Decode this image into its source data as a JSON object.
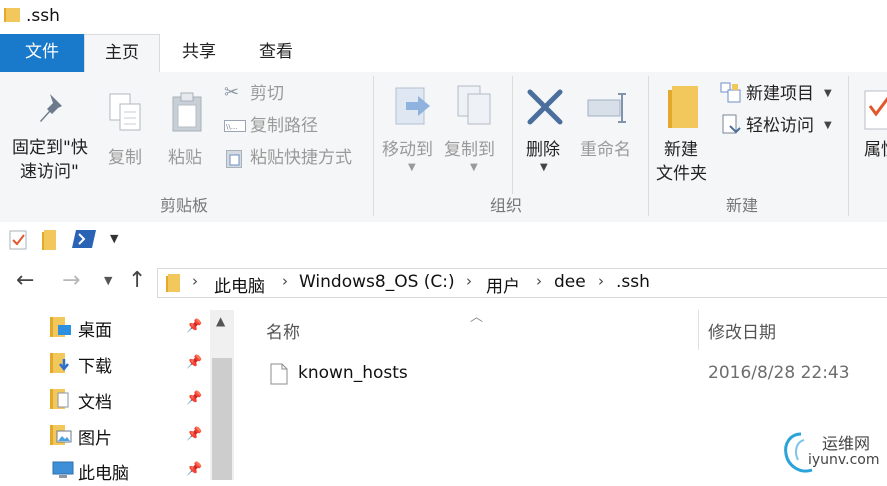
{
  "window": {
    "title": ".ssh"
  },
  "tabs": [
    {
      "label": "文件"
    },
    {
      "label": "主页"
    },
    {
      "label": "共享"
    },
    {
      "label": "查看"
    }
  ],
  "ribbon": {
    "clipboard": {
      "pin_label_1": "固定到\"快",
      "pin_label_2": "速访问\"",
      "copy": "复制",
      "paste": "粘贴",
      "cut": "剪切",
      "copy_path": "复制路径",
      "paste_shortcut": "粘贴快捷方式",
      "group": "剪贴板"
    },
    "organize": {
      "move_to": "移动到",
      "copy_to": "复制到",
      "delete": "删除",
      "rename": "重命名",
      "group": "组织"
    },
    "new": {
      "new_folder_1": "新建",
      "new_folder_2": "文件夹",
      "new_item": "新建项目",
      "easy_access": "轻松访问",
      "group": "新建"
    },
    "open": {
      "properties": "属性"
    }
  },
  "address": {
    "crumbs": [
      "此电脑",
      "Windows8_OS (C:)",
      "用户",
      "dee",
      ".ssh"
    ]
  },
  "nav": {
    "items": [
      {
        "label": "桌面"
      },
      {
        "label": "下载"
      },
      {
        "label": "文档"
      },
      {
        "label": "图片"
      },
      {
        "label": "此电脑"
      }
    ]
  },
  "filelist": {
    "columns": {
      "name": "名称",
      "modified": "修改日期"
    },
    "rows": [
      {
        "name": "known_hosts",
        "modified": "2016/8/28 22:43"
      }
    ]
  },
  "watermark": {
    "brand": "运维网",
    "url": "iyunv.com"
  },
  "colors": {
    "accent": "#1979ca",
    "folder": "#f2c75c",
    "ribbon_bg": "#f5f6f7"
  }
}
